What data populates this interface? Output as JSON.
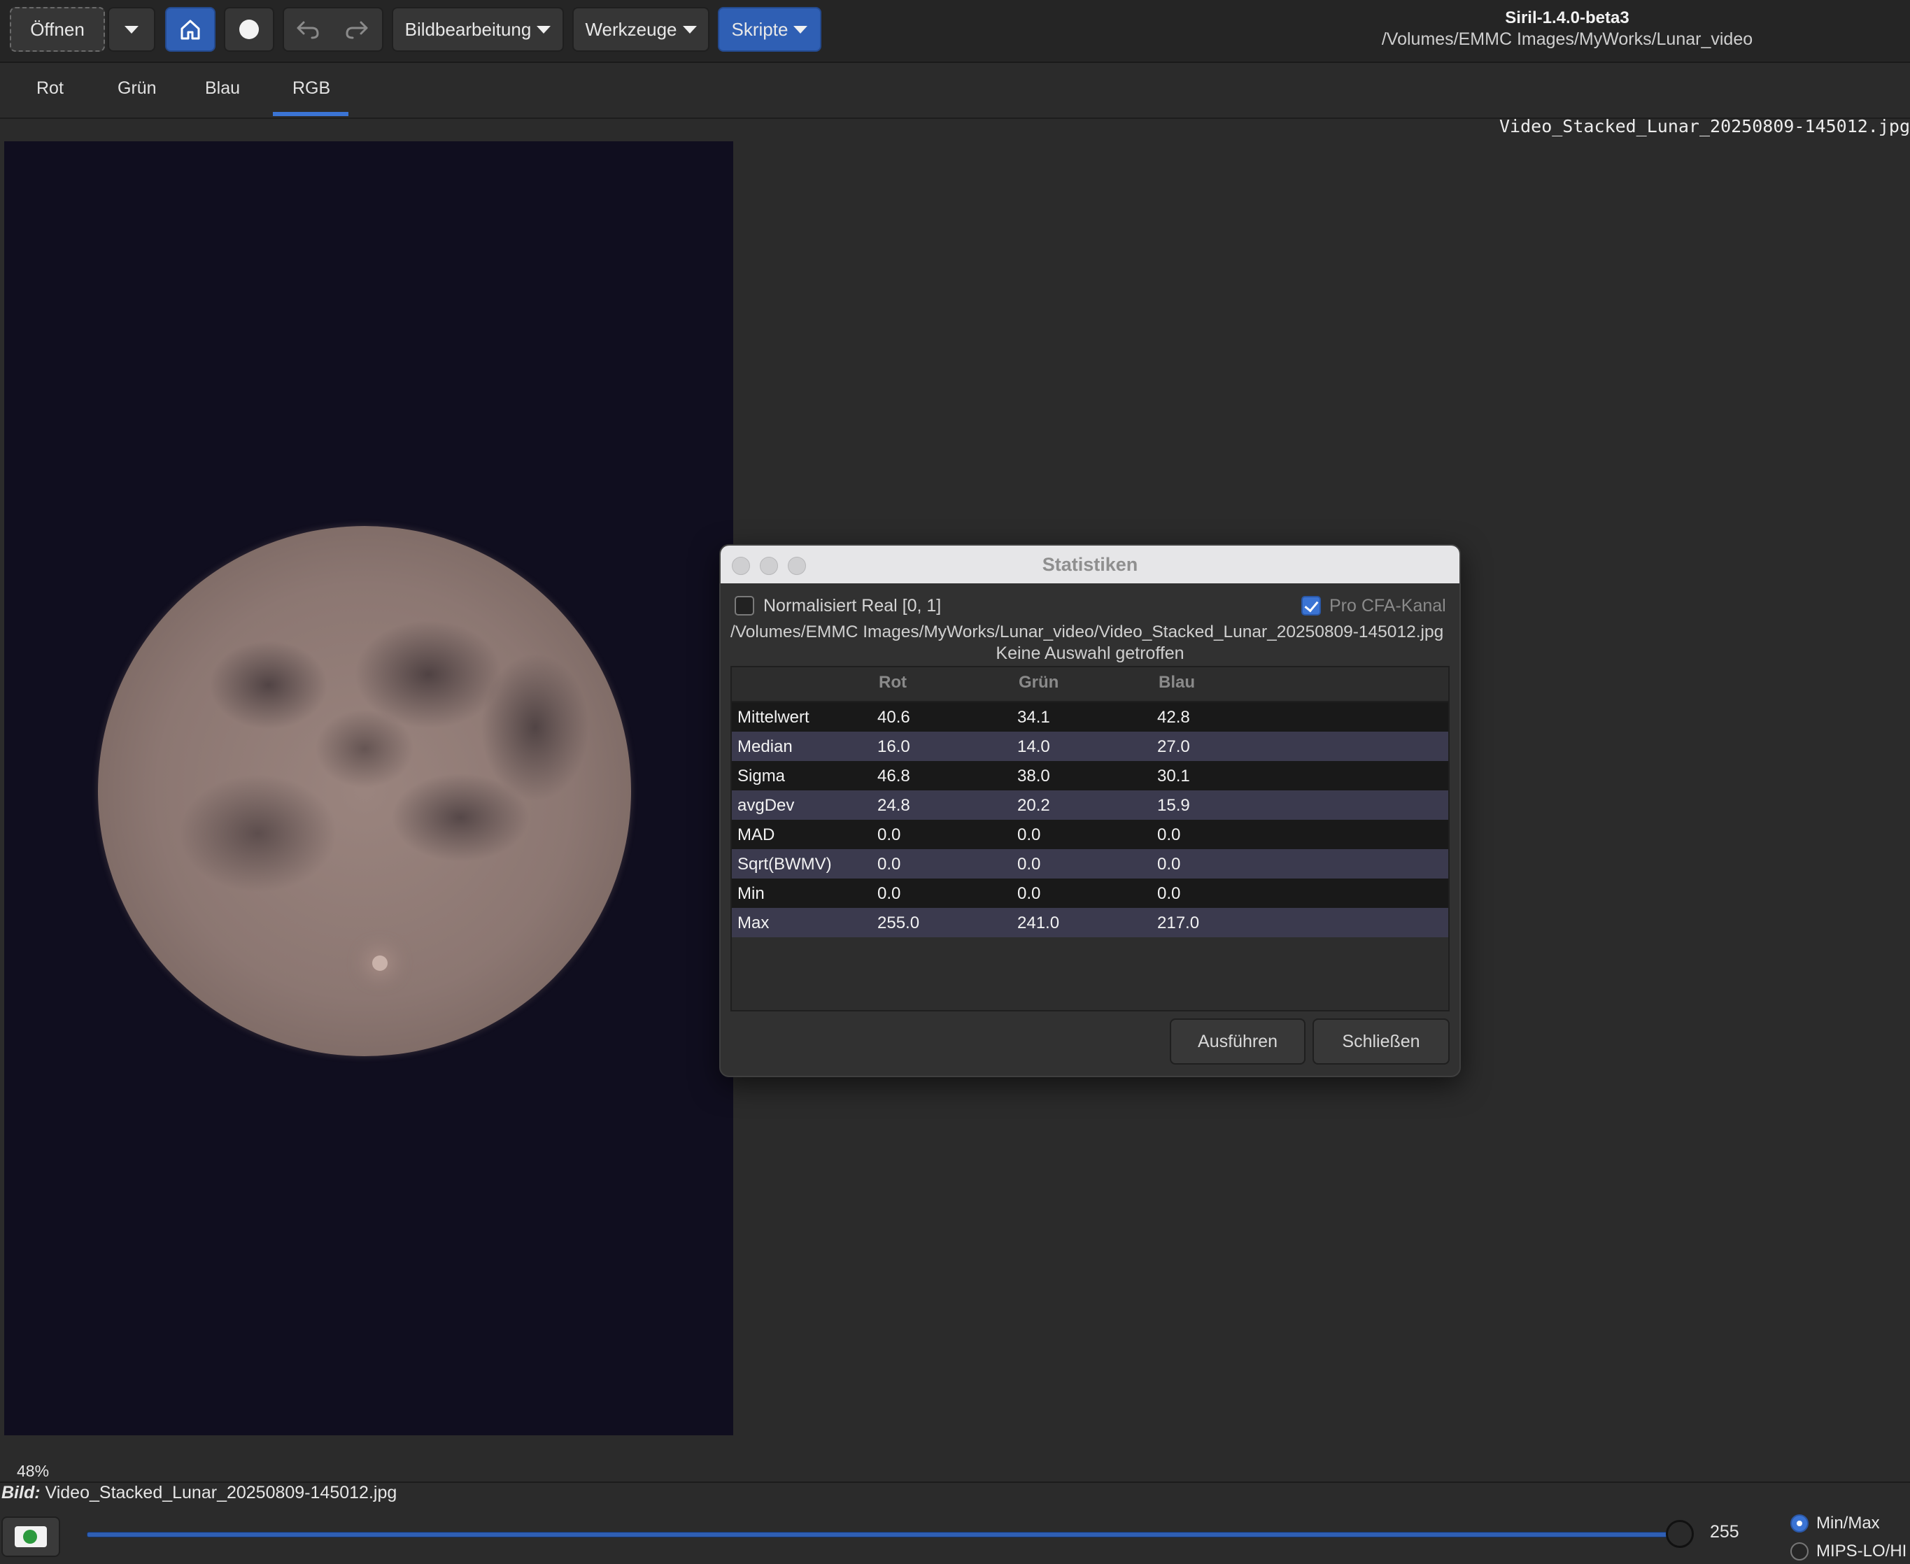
{
  "window": {
    "app_title": "Siril-1.4.0-beta3",
    "working_dir": "/Volumes/EMMC Images/MyWorks/Lunar_video"
  },
  "toolbar": {
    "open_label": "Öffnen",
    "image_processing_label": "Bildbearbeitung",
    "tools_label": "Werkzeuge",
    "scripts_label": "Skripte"
  },
  "tabs": [
    {
      "label": "Rot"
    },
    {
      "label": "Grün"
    },
    {
      "label": "Blau"
    },
    {
      "label": "RGB",
      "active": true
    }
  ],
  "image": {
    "filename_overlay": "Video_Stacked_Lunar_20250809-145012.jpg",
    "zoom": "48%"
  },
  "status": {
    "bild_label": "Bild:",
    "bild_value": "Video_Stacked_Lunar_20250809-145012.jpg",
    "slider_value": "255",
    "mode_options": [
      "Min/Max",
      "MIPS-LO/HI"
    ],
    "mode_selected": "Min/Max"
  },
  "dialog": {
    "title": "Statistiken",
    "normalized_label": "Normalisiert Real [0, 1]",
    "normalized_checked": false,
    "per_cfa_label": "Pro CFA-Kanal",
    "per_cfa_checked": true,
    "path": "/Volumes/EMMC Images/MyWorks/Lunar_video/Video_Stacked_Lunar_20250809-145012.jpg",
    "selection_note": "Keine Auswahl getroffen",
    "columns": [
      "",
      "Rot",
      "Grün",
      "Blau"
    ],
    "rows": [
      [
        "Mittelwert",
        "40.6",
        "34.1",
        "42.8"
      ],
      [
        "Median",
        "16.0",
        "14.0",
        "27.0"
      ],
      [
        "Sigma",
        "46.8",
        "38.0",
        "30.1"
      ],
      [
        "avgDev",
        "24.8",
        "20.2",
        "15.9"
      ],
      [
        "MAD",
        "0.0",
        "0.0",
        "0.0"
      ],
      [
        "Sqrt(BWMV)",
        "0.0",
        "0.0",
        "0.0"
      ],
      [
        "Min",
        "0.0",
        "0.0",
        "0.0"
      ],
      [
        "Max",
        "255.0",
        "241.0",
        "217.0"
      ]
    ],
    "run_label": "Ausführen",
    "close_label": "Schließen"
  },
  "colors": {
    "accent": "#2f5fb4",
    "canvas_bg": "#100e1f",
    "row_alt": "#3b3a4e"
  }
}
